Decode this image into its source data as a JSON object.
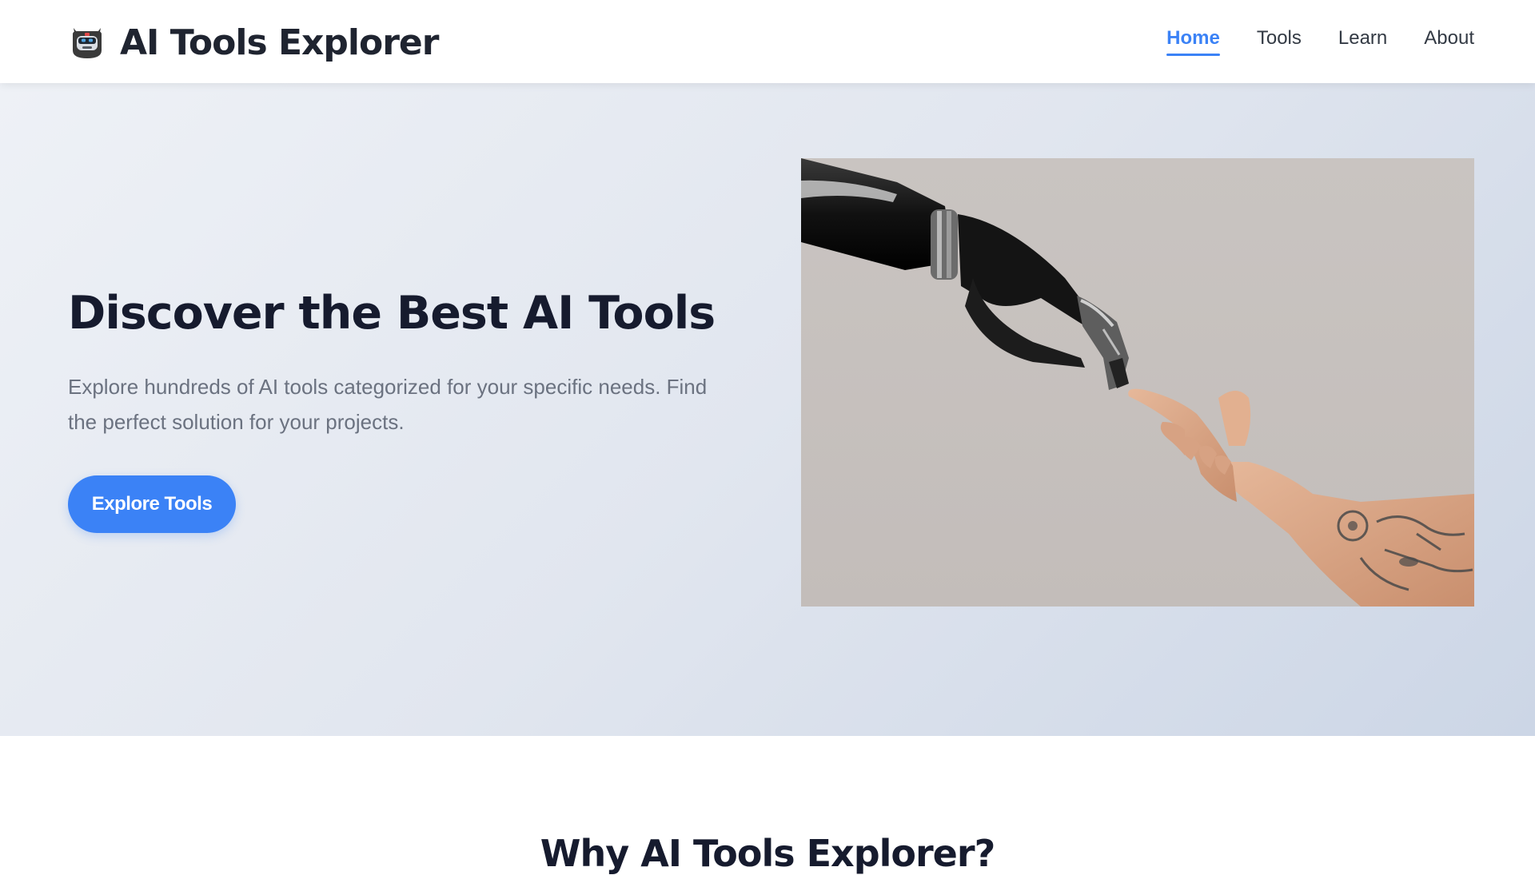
{
  "brand": {
    "name": "AI Tools Explorer",
    "logo_icon": "robot-head-icon"
  },
  "nav": {
    "items": [
      {
        "label": "Home",
        "active": true
      },
      {
        "label": "Tools",
        "active": false
      },
      {
        "label": "Learn",
        "active": false
      },
      {
        "label": "About",
        "active": false
      }
    ]
  },
  "hero": {
    "title": "Discover the Best AI Tools",
    "description": "Explore hundreds of AI tools categorized for your specific needs. Find the perfect solution for your projects.",
    "cta_label": "Explore Tools",
    "image_subject": "robotic hand reaching toward human hand"
  },
  "why": {
    "title": "Why AI Tools Explorer?"
  },
  "colors": {
    "accent": "#3b82f6",
    "heading": "#161b2e",
    "body_text": "#6b7280"
  }
}
